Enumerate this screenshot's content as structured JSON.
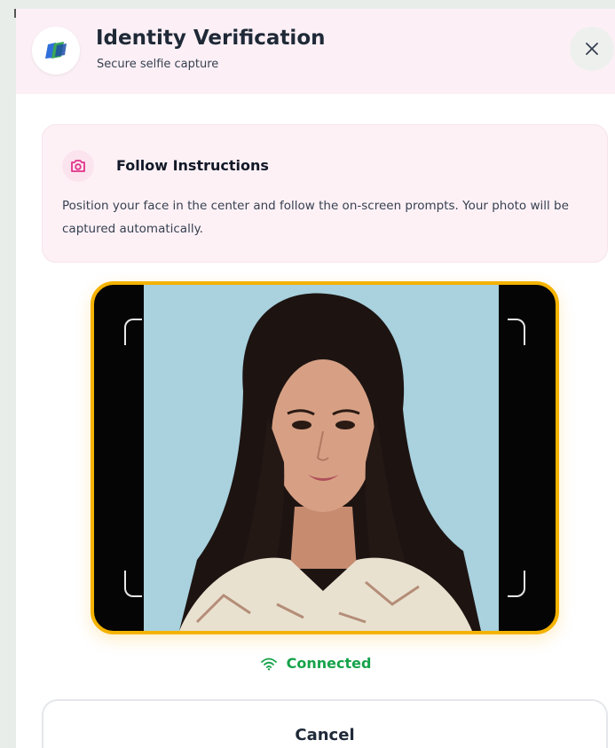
{
  "header": {
    "title": "Identity Verification",
    "subtitle": "Secure selfie capture",
    "close_icon": "close-icon",
    "logo_icon": "id-card-logo"
  },
  "instructions": {
    "icon": "camera-icon",
    "title": "Follow Instructions",
    "body": "Position your face in the center and follow the on-screen prompts. Your photo will be captured automatically."
  },
  "camera": {
    "frame_color": "#f5b301"
  },
  "status": {
    "icon": "wifi-icon",
    "label": "Connected",
    "color": "#16a34a"
  },
  "actions": {
    "cancel_label": "Cancel"
  }
}
